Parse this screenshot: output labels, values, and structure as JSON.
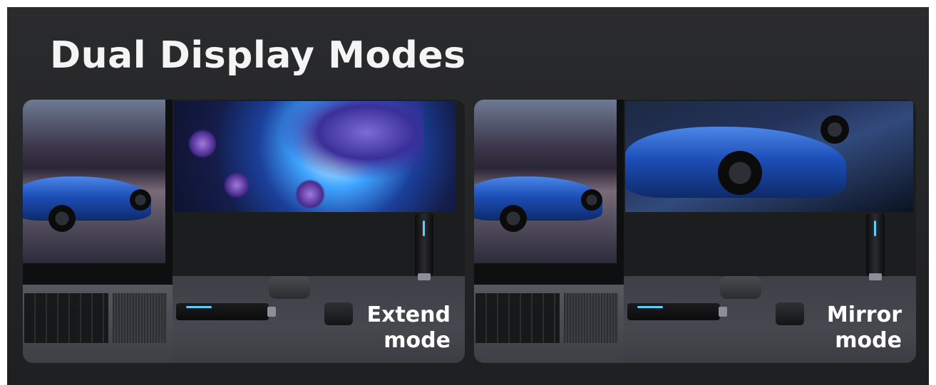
{
  "title": "Dual Display Modes",
  "panels": [
    {
      "label_line1": "Extend",
      "label_line2": "mode"
    },
    {
      "label_line1": "Mirror",
      "label_line2": "mode"
    }
  ]
}
